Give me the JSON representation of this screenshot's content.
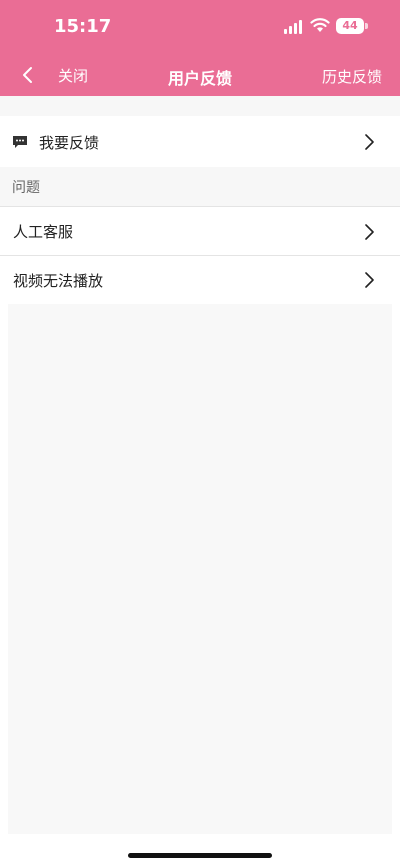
{
  "status": {
    "time": "15:17",
    "battery": "44",
    "icons": [
      "cellular-signal-icon",
      "wifi-icon",
      "battery-icon"
    ]
  },
  "nav": {
    "close_label": "关闭",
    "title": "用户反馈",
    "history_label": "历史反馈"
  },
  "feedback": {
    "label": "我要反馈",
    "icon": "message-icon"
  },
  "section": {
    "title": "问题"
  },
  "questions": [
    {
      "label": "人工客服"
    },
    {
      "label": "视频无法播放"
    }
  ],
  "colors": {
    "header": "#ea6d95",
    "background": "#f7f7f7"
  }
}
